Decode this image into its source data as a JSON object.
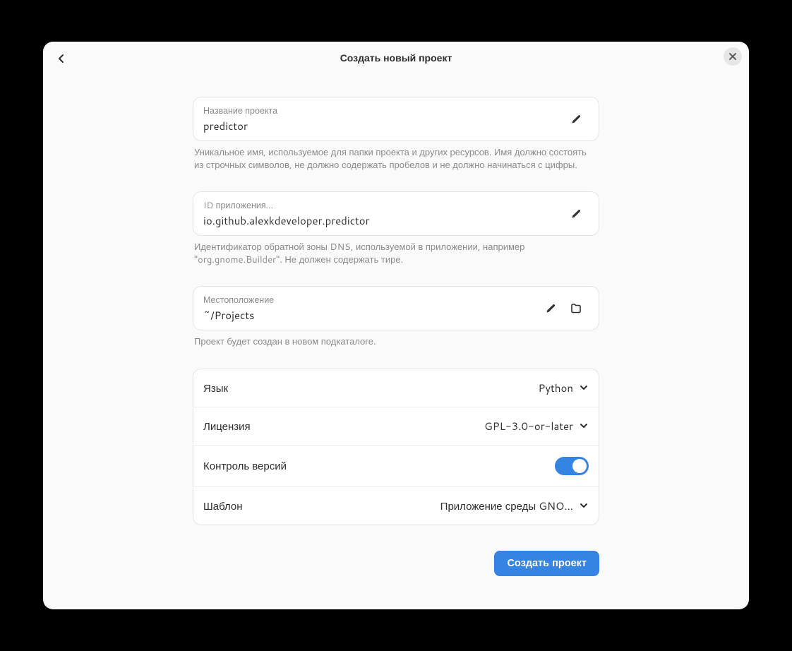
{
  "header": {
    "title": "Создать новый проект"
  },
  "fields": {
    "project_name": {
      "label": "Название проекта",
      "value": "predictor",
      "help": "Уникальное имя, используемое для папки проекта и других ресурсов. Имя должно состоять из строчных символов, не должно содержать пробелов и не должно начинаться с цифры."
    },
    "app_id": {
      "label": "ID приложения…",
      "value": "io.github.alexkdeveloper.predictor",
      "help": "Идентификатор обратной зоны DNS, используемой в приложении, например \"org.gnome.Builder\". Не должен содержать тире."
    },
    "location": {
      "label": "Местоположение",
      "value": "~/Projects",
      "help": "Проект будет создан в новом подкаталоге."
    }
  },
  "options": {
    "language": {
      "label": "Язык",
      "value": "Python"
    },
    "license": {
      "label": "Лицензия",
      "value": "GPL-3.0-or-later"
    },
    "vcs": {
      "label": "Контроль версий",
      "enabled": true
    },
    "template": {
      "label": "Шаблон",
      "value": "Приложение среды GNO…"
    }
  },
  "buttons": {
    "create": "Создать проект"
  }
}
